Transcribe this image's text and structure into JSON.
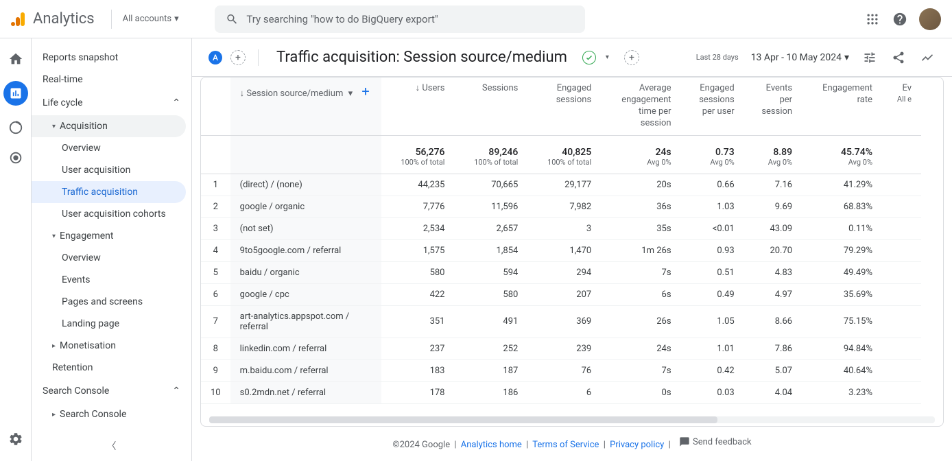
{
  "header": {
    "app_name": "Analytics",
    "accounts_label": "All accounts",
    "search_placeholder": "Try searching \"how to do BigQuery export\""
  },
  "sidebar": {
    "items": [
      {
        "label": "Reports snapshot",
        "level": 1
      },
      {
        "label": "Real-time",
        "level": 1
      }
    ],
    "lifecycle_label": "Life cycle",
    "acquisition": {
      "label": "Acquisition",
      "children": [
        "Overview",
        "User acquisition",
        "Traffic acquisition",
        "User acquisition cohorts"
      ]
    },
    "engagement": {
      "label": "Engagement",
      "children": [
        "Overview",
        "Events",
        "Pages and screens",
        "Landing page"
      ]
    },
    "monetisation_label": "Monetisation",
    "retention_label": "Retention",
    "searchconsole_group": "Search Console",
    "searchconsole_item": "Search Console"
  },
  "page": {
    "badge": "A",
    "title": "Traffic acquisition: Session source/medium",
    "date_label": "Last 28 days",
    "date_range": "13 Apr - 10 May 2024"
  },
  "table": {
    "dim_header": "Session source/medium",
    "columns": [
      "Users",
      "Sessions",
      "Engaged sessions",
      "Average engagement time per session",
      "Engaged sessions per user",
      "Events per session",
      "Engagement rate",
      "Ev"
    ],
    "col_note_last": "All e",
    "totals": {
      "users": {
        "v": "56,276",
        "s": "100% of total"
      },
      "sessions": {
        "v": "89,246",
        "s": "100% of total"
      },
      "engaged": {
        "v": "40,825",
        "s": "100% of total"
      },
      "avgtime": {
        "v": "24s",
        "s": "Avg 0%"
      },
      "espu": {
        "v": "0.73",
        "s": "Avg 0%"
      },
      "eps": {
        "v": "8.89",
        "s": "Avg 0%"
      },
      "rate": {
        "v": "45.74%",
        "s": "Avg 0%"
      }
    },
    "rows": [
      {
        "n": "1",
        "dim": "(direct) / (none)",
        "users": "44,235",
        "sessions": "70,665",
        "engaged": "29,177",
        "avgtime": "20s",
        "espu": "0.66",
        "eps": "7.16",
        "rate": "41.29%"
      },
      {
        "n": "2",
        "dim": "google / organic",
        "users": "7,776",
        "sessions": "11,596",
        "engaged": "7,982",
        "avgtime": "36s",
        "espu": "1.03",
        "eps": "9.69",
        "rate": "68.83%"
      },
      {
        "n": "3",
        "dim": "(not set)",
        "users": "2,534",
        "sessions": "2,657",
        "engaged": "3",
        "avgtime": "35s",
        "espu": "<0.01",
        "eps": "43.09",
        "rate": "0.11%"
      },
      {
        "n": "4",
        "dim": "9to5google.com / referral",
        "users": "1,575",
        "sessions": "1,854",
        "engaged": "1,470",
        "avgtime": "1m 26s",
        "espu": "0.93",
        "eps": "20.70",
        "rate": "79.29%"
      },
      {
        "n": "5",
        "dim": "baidu / organic",
        "users": "580",
        "sessions": "594",
        "engaged": "294",
        "avgtime": "7s",
        "espu": "0.51",
        "eps": "4.83",
        "rate": "49.49%"
      },
      {
        "n": "6",
        "dim": "google / cpc",
        "users": "422",
        "sessions": "580",
        "engaged": "207",
        "avgtime": "6s",
        "espu": "0.49",
        "eps": "4.97",
        "rate": "35.69%"
      },
      {
        "n": "7",
        "dim": "art-analytics.appspot.com / referral",
        "users": "351",
        "sessions": "491",
        "engaged": "369",
        "avgtime": "26s",
        "espu": "1.05",
        "eps": "8.66",
        "rate": "75.15%"
      },
      {
        "n": "8",
        "dim": "linkedin.com / referral",
        "users": "237",
        "sessions": "252",
        "engaged": "239",
        "avgtime": "24s",
        "espu": "1.01",
        "eps": "7.86",
        "rate": "94.84%"
      },
      {
        "n": "9",
        "dim": "m.baidu.com / referral",
        "users": "183",
        "sessions": "187",
        "engaged": "76",
        "avgtime": "7s",
        "espu": "0.42",
        "eps": "5.07",
        "rate": "40.64%"
      },
      {
        "n": "10",
        "dim": "s0.2mdn.net / referral",
        "users": "178",
        "sessions": "186",
        "engaged": "6",
        "avgtime": "0s",
        "espu": "0.03",
        "eps": "4.04",
        "rate": "3.23%"
      }
    ]
  },
  "footer": {
    "copyright": "©2024 Google",
    "links": [
      "Analytics home",
      "Terms of Service",
      "Privacy policy"
    ],
    "feedback": "Send feedback"
  }
}
